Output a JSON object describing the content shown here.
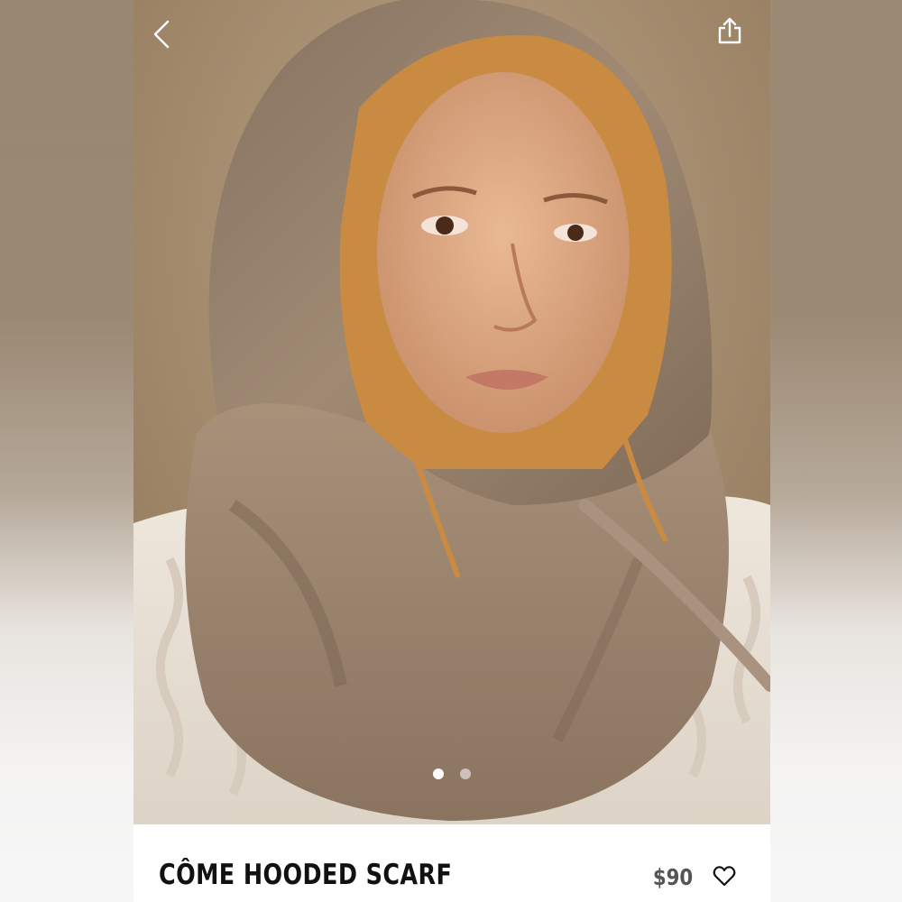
{
  "product": {
    "name": "CÔME HOODED SCARF",
    "price": "$90"
  },
  "carousel": {
    "count": 2,
    "active": 1
  },
  "icons": {
    "back": "chevron-left-icon",
    "share": "share-icon",
    "wishlist": "heart-outline-icon"
  },
  "colors": {
    "scarf": "#9c8670",
    "sweater": "#efe9e0",
    "background": "#ad9677",
    "title_text": "#111111",
    "price_text": "#555555"
  }
}
